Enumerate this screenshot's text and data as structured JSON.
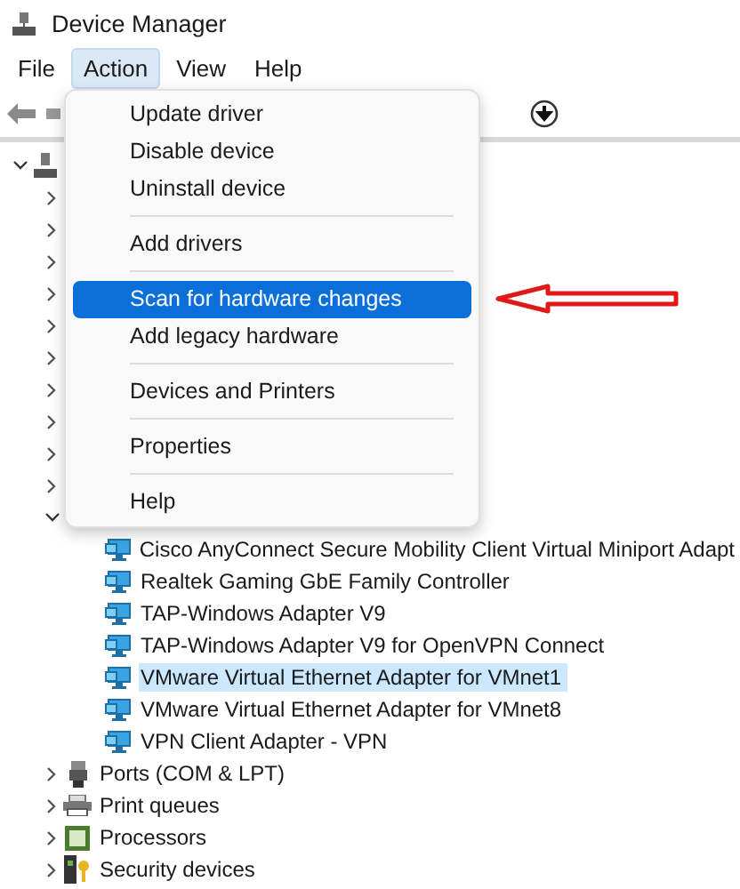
{
  "window": {
    "title": "Device Manager"
  },
  "menu_bar": [
    {
      "label": "File",
      "selected": false
    },
    {
      "label": "Action",
      "selected": true
    },
    {
      "label": "View",
      "selected": false
    },
    {
      "label": "Help",
      "selected": false
    }
  ],
  "tree": {
    "expanded": true,
    "children": [
      {
        "expanded": false
      },
      {
        "expanded": false
      },
      {
        "expanded": false
      },
      {
        "expanded": false
      },
      {
        "expanded": false
      },
      {
        "expanded": false
      },
      {
        "expanded": false
      },
      {
        "expanded": false
      },
      {
        "expanded": false
      },
      {
        "expanded": false
      },
      {
        "expanded": true,
        "children": [
          {
            "label": "Cisco AnyConnect Secure Mobility Client Virtual Miniport Adapt",
            "selected": false
          },
          {
            "label": "Realtek Gaming GbE Family Controller",
            "selected": false
          },
          {
            "label": "TAP-Windows Adapter V9",
            "selected": false
          },
          {
            "label": "TAP-Windows Adapter V9 for OpenVPN Connect",
            "selected": false
          },
          {
            "label": "VMware Virtual Ethernet Adapter for VMnet1",
            "selected": true
          },
          {
            "label": "VMware Virtual Ethernet Adapter for VMnet8",
            "selected": false
          },
          {
            "label": "VPN Client Adapter - VPN",
            "selected": false
          }
        ]
      },
      {
        "label": "Ports (COM & LPT)",
        "expanded": false
      },
      {
        "label": "Print queues",
        "expanded": false
      },
      {
        "label": "Processors",
        "expanded": false
      },
      {
        "label": "Security devices",
        "expanded": false
      }
    ]
  },
  "action_menu": [
    {
      "kind": "item",
      "label": "Update driver",
      "selected": false
    },
    {
      "kind": "item",
      "label": "Disable device",
      "selected": false
    },
    {
      "kind": "item",
      "label": "Uninstall device",
      "selected": false
    },
    {
      "kind": "separator"
    },
    {
      "kind": "item",
      "label": "Add drivers",
      "selected": false
    },
    {
      "kind": "separator"
    },
    {
      "kind": "item",
      "label": "Scan for hardware changes",
      "selected": true
    },
    {
      "kind": "item",
      "label": "Add legacy hardware",
      "selected": false
    },
    {
      "kind": "separator"
    },
    {
      "kind": "item",
      "label": "Devices and Printers",
      "selected": false
    },
    {
      "kind": "separator"
    },
    {
      "kind": "item",
      "label": "Properties",
      "selected": false
    },
    {
      "kind": "separator"
    },
    {
      "kind": "item",
      "label": "Help",
      "selected": false
    }
  ]
}
